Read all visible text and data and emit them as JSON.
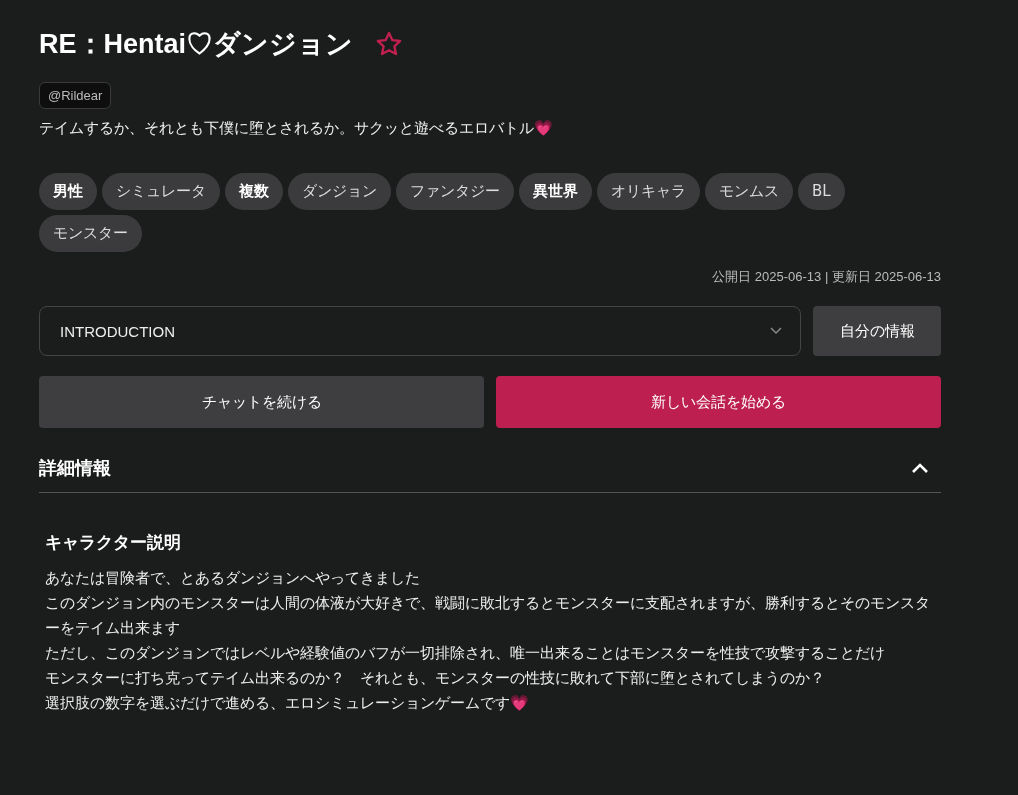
{
  "title": "RE：Hentai♡ダンジョン",
  "favorited": false,
  "author": "@Rildear",
  "tagline": "テイムするか、それとも下僕に堕とされるか。サクッと遊べるエロバトル💗",
  "tags": [
    {
      "label": "男性",
      "emphasized": true
    },
    {
      "label": "シミュレータ",
      "emphasized": false
    },
    {
      "label": "複数",
      "emphasized": true
    },
    {
      "label": "ダンジョン",
      "emphasized": false
    },
    {
      "label": "ファンタジー",
      "emphasized": false
    },
    {
      "label": "異世界",
      "emphasized": true
    },
    {
      "label": "オリキャラ",
      "emphasized": false
    },
    {
      "label": "モンムス",
      "emphasized": false
    },
    {
      "label": "BL",
      "emphasized": false
    },
    {
      "label": "モンスター",
      "emphasized": false
    }
  ],
  "dates": "公開日 2025-06-13 | 更新日 2025-06-13",
  "scenario_select": {
    "value": "INTRODUCTION"
  },
  "profile_button": "自分の情報",
  "continue_button": "チャットを続ける",
  "new_chat_button": "新しい会話を始める",
  "details": {
    "heading": "詳細情報",
    "expanded": true,
    "section_title": "キャラクター説明",
    "lines": [
      "あなたは冒険者で、とあるダンジョンへやってきました",
      "このダンジョン内のモンスターは人間の体液が大好きで、戦闘に敗北するとモンスターに支配されますが、勝利するとそのモンスターをテイム出来ます",
      "ただし、このダンジョンではレベルや経験値のバフが一切排除され、唯一出来ることはモンスターを性技で攻撃することだけ",
      "モンスターに打ち克ってテイム出来るのか？　それとも、モンスターの性技に敗れて下部に堕とされてしまうのか？",
      "選択肢の数字を選ぶだけで進める、エロシミュレーションゲームです💗"
    ]
  }
}
